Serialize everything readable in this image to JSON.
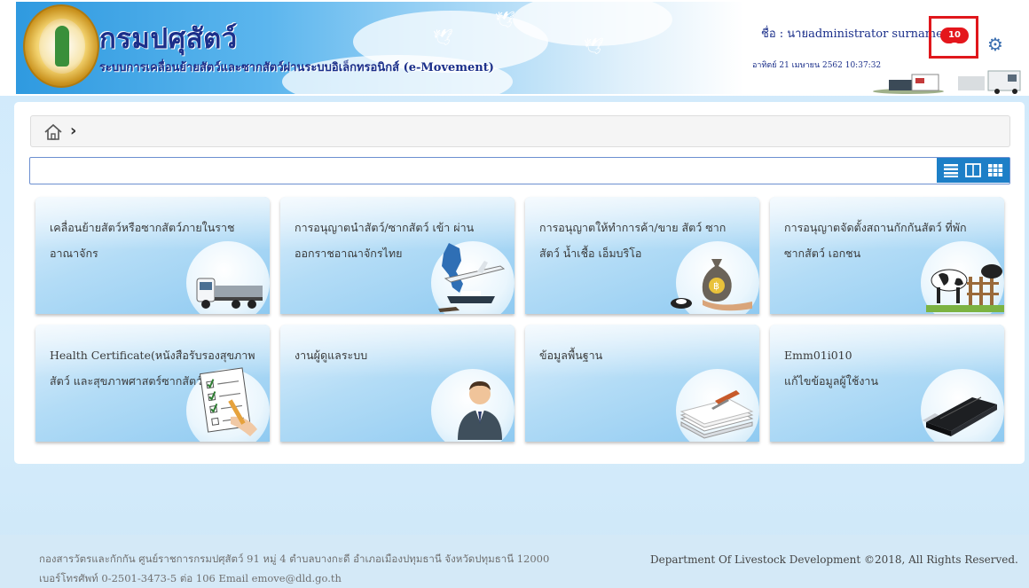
{
  "header": {
    "org_title": "กรมปศุสัตว์",
    "org_subtitle": "ระบบการเคลื่อนย้ายสัตว์และซากสัตว์ผ่านระบบอิเล็กทรอนิกส์ (e-Movement)",
    "user_name": "ชื่อ : นายadministrator surname",
    "datetime": "อาทิตย์ 21 เมษายน 2562 10:37:32",
    "notification_count": "10",
    "icons": {
      "notifications": "bell-icon",
      "settings": "gear-icon"
    },
    "colors": {
      "title": "#1b2f8a",
      "badge": "#e4161c",
      "highlight_box": "#e0171c"
    }
  },
  "breadcrumb": {
    "home_icon": "home-icon",
    "separator": "›"
  },
  "search": {
    "value": "",
    "placeholder": ""
  },
  "view_toggle": {
    "buttons": [
      "list-view-icon",
      "column-view-icon",
      "grid-view-icon"
    ],
    "color": "#1d7fc7"
  },
  "tiles": [
    {
      "label": "เคลื่อนย้ายสัตว์หรือซากสัตว์ภายในราชอาณาจักร",
      "icon": "truck-icon"
    },
    {
      "label": "การอนุญาตนำสัตว์/ซากสัตว์ เข้า ผ่าน ออกราชอาณาจักรไทย",
      "icon": "transport-map-icon"
    },
    {
      "label": "การอนุญาตให้ทำการค้า/ขาย สัตว์ ซากสัตว์ น้ำเชื้อ เอ็มบริโอ",
      "icon": "money-bag-icon"
    },
    {
      "label": "การอนุญาตจัดตั้งสถานกักกันสัตว์ ที่พักซากสัตว์ เอกชน",
      "icon": "cattle-pen-icon"
    },
    {
      "label": "Health Certificate(หนังสือรับรองสุขภาพสัตว์ และสุขภาพศาสตร์ซากสัตว์)",
      "icon": "checklist-icon"
    },
    {
      "label": "งานผู้ดูแลระบบ",
      "icon": "admin-user-icon"
    },
    {
      "label": "ข้อมูลพื้นฐาน",
      "icon": "documents-stack-icon"
    },
    {
      "label": "Emm01i010\nแก้ไขข้อมูลผู้ใช้งาน",
      "icon": "usb-drive-icon"
    }
  ],
  "footer": {
    "address_line1": "กองสารวัตรและกักกัน ศูนย์ราชการกรมปศุสัตว์ 91 หมู่ 4 ตำบลบางกะดี อำเภอเมืองปทุมธานี จังหวัดปทุมธานี 12000",
    "address_line2": "เบอร์โทรศัพท์ 0-2501-3473-5 ต่อ 106 Email emove@dld.go.th",
    "copyright": "Department Of Livestock Development ©2018, All Rights Reserved."
  }
}
